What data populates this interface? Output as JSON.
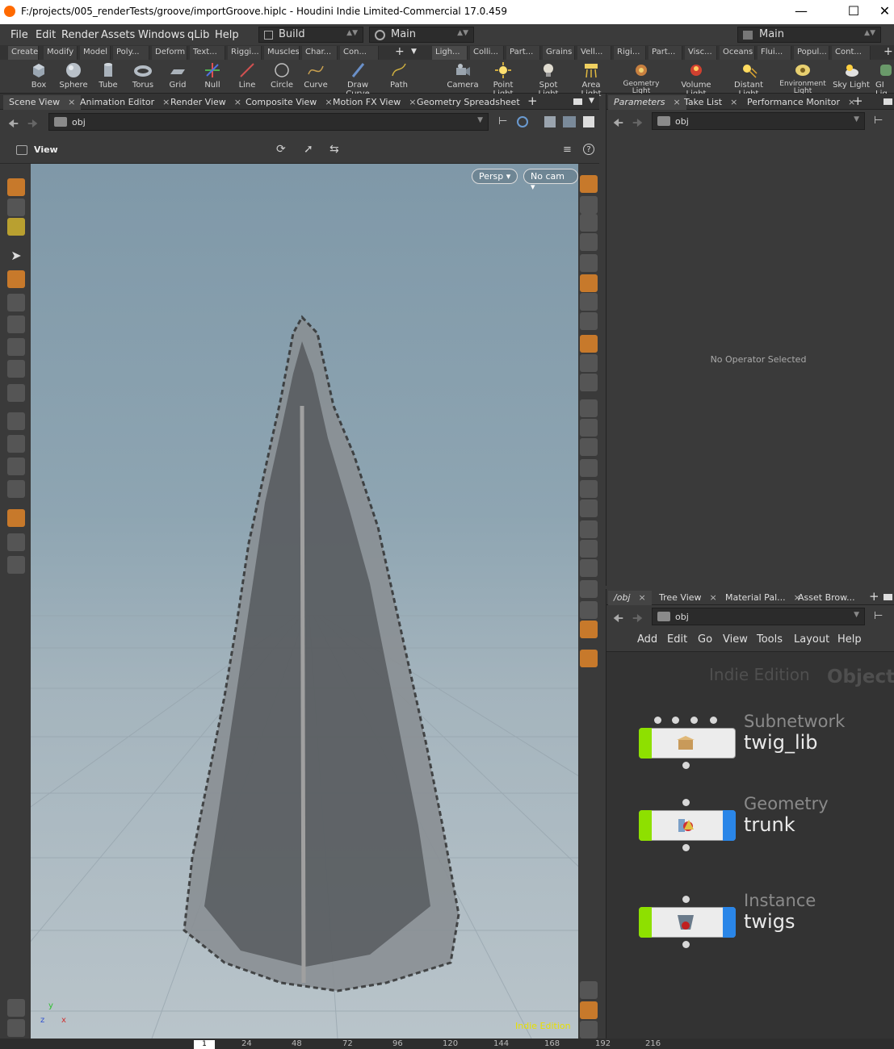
{
  "window": {
    "title": "F:/projects/005_renderTests/groove/importGroove.hiplc - Houdini Indie Limited-Commercial 17.0.459"
  },
  "menu": {
    "items": [
      "File",
      "Edit",
      "Render",
      "Assets",
      "Windows",
      "qLib",
      "Help"
    ],
    "desktop": "Build",
    "pane_set": "Main",
    "right_desktop": "Main"
  },
  "shelf_tabs_left": [
    "Create",
    "Modify",
    "Model",
    "Poly...",
    "Deform",
    "Text...",
    "Riggi...",
    "Muscles",
    "Char...",
    "Con..."
  ],
  "shelf_tabs_right": [
    "Ligh...",
    "Colli...",
    "Part...",
    "Grains",
    "Vell...",
    "Rigi...",
    "Part...",
    "Visc...",
    "Oceans",
    "Flui...",
    "Popul...",
    "Cont..."
  ],
  "tools_left": [
    {
      "label": "Box",
      "icon": "box-icon"
    },
    {
      "label": "Sphere",
      "icon": "sphere-icon"
    },
    {
      "label": "Tube",
      "icon": "tube-icon"
    },
    {
      "label": "Torus",
      "icon": "torus-icon"
    },
    {
      "label": "Grid",
      "icon": "grid-icon"
    },
    {
      "label": "Null",
      "icon": "null-icon"
    },
    {
      "label": "Line",
      "icon": "line-icon"
    },
    {
      "label": "Circle",
      "icon": "circle-icon"
    },
    {
      "label": "Curve",
      "icon": "curve-icon"
    },
    {
      "label": "Draw Curve",
      "icon": "draw-curve-icon"
    },
    {
      "label": "Path",
      "icon": "path-icon"
    }
  ],
  "tools_right": [
    {
      "label": "Camera",
      "icon": "camera-icon"
    },
    {
      "label": "Point Light",
      "icon": "point-light-icon"
    },
    {
      "label": "Spot Light",
      "icon": "spot-light-icon"
    },
    {
      "label": "Area Light",
      "icon": "area-light-icon"
    },
    {
      "label": "Geometry Light",
      "icon": "geometry-light-icon"
    },
    {
      "label": "Volume Light",
      "icon": "volume-light-icon"
    },
    {
      "label": "Distant Light",
      "icon": "distant-light-icon"
    },
    {
      "label": "Environment Light",
      "icon": "environment-light-icon"
    },
    {
      "label": "Sky Light",
      "icon": "sky-light-icon"
    },
    {
      "label": "GI Lig...",
      "icon": "gi-light-icon"
    }
  ],
  "left_pane_tabs": [
    "Scene View",
    "Animation Editor",
    "Render View",
    "Composite View",
    "Motion FX View",
    "Geometry Spreadsheet"
  ],
  "left_path": "obj",
  "view_label": "View",
  "viewport": {
    "persp_label": "Persp",
    "cam_label": "No cam",
    "watermark": "Indie Edition",
    "axis_x": "x",
    "axis_y": "y",
    "axis_z": "z"
  },
  "param_tabs": [
    "Parameters",
    "Take List",
    "Performance Monitor"
  ],
  "param_path": "obj",
  "param_empty": "No Operator Selected",
  "net_tabs": [
    "/obj",
    "Tree View",
    "Material Pal...",
    "Asset Brow..."
  ],
  "net_path": "obj",
  "net_menu": [
    "Add",
    "Edit",
    "Go",
    "View",
    "Tools",
    "Layout",
    "Help"
  ],
  "net_watermark": "Indie Edition",
  "net_context": "Objects",
  "nodes": [
    {
      "type": "Subnetwork",
      "name": "twig_lib"
    },
    {
      "type": "Geometry",
      "name": "trunk"
    },
    {
      "type": "Instance",
      "name": "twigs"
    }
  ],
  "timeline": {
    "current": "1",
    "ticks": [
      "24",
      "48",
      "72",
      "96",
      "120",
      "144",
      "168",
      "192",
      "216"
    ]
  },
  "colors": {
    "accent": "#c7792b",
    "node_flag_green": "#8ee000",
    "node_flag_blue": "#2a86e8",
    "watermark_yellow": "#e8e000"
  }
}
